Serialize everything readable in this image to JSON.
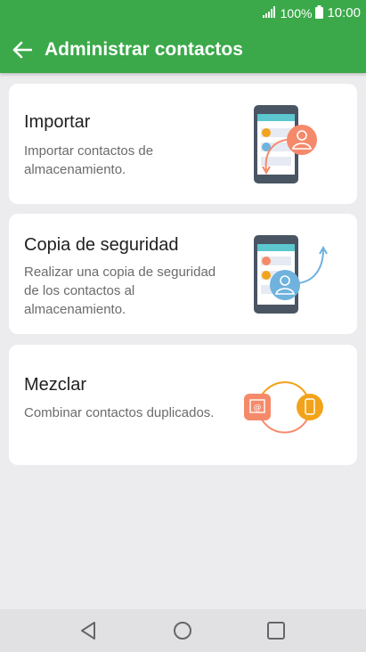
{
  "status": {
    "battery": "100%",
    "time": "10:00",
    "signal_icon": "signal-icon",
    "battery_icon": "battery-icon"
  },
  "appbar": {
    "title": "Administrar contactos",
    "back_icon": "back-arrow-icon"
  },
  "cards": [
    {
      "title": "Importar",
      "description": "Importar contactos de almacenamiento.",
      "icon": "import-illustration"
    },
    {
      "title": "Copia de seguridad",
      "description": "Realizar una copia de seguridad de los contactos al almacenamiento.",
      "icon": "backup-illustration"
    },
    {
      "title": "Mezclar",
      "description": "Combinar contactos duplicados.",
      "icon": "merge-illustration"
    }
  ],
  "navbar": {
    "back_icon": "nav-back-icon",
    "home_icon": "nav-home-icon",
    "recents_icon": "nav-recents-icon"
  },
  "colors": {
    "accent": "#3ba94a",
    "background": "#ececee",
    "orange": "#f58a6b",
    "blue": "#6fb2de",
    "yellow": "#f2a31b"
  }
}
